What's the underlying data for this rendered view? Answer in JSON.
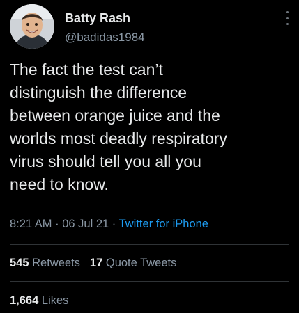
{
  "author": {
    "display_name": "Batty Rash",
    "handle": "@badidas1984"
  },
  "tweet": {
    "text": "The fact the test can’t\ndistinguish the difference\nbetween orange juice and the\nworlds most deadly respiratory\nvirus should tell you all you\nneed to know.",
    "time": "8:21 AM",
    "date": "06 Jul 21",
    "separator": "·",
    "source": "Twitter for iPhone"
  },
  "stats": {
    "retweets_count": "545",
    "retweets_label": "Retweets",
    "quotes_count": "17",
    "quotes_label": "Quote Tweets",
    "likes_count": "1,664",
    "likes_label": "Likes"
  },
  "icons": {
    "more": "more-vertical-icon",
    "avatar": "profile-photo"
  },
  "colors": {
    "background": "#000000",
    "text": "#e7e9ea",
    "secondary": "#8b98a5",
    "link": "#1d9bf0",
    "divider": "#2f3336"
  }
}
